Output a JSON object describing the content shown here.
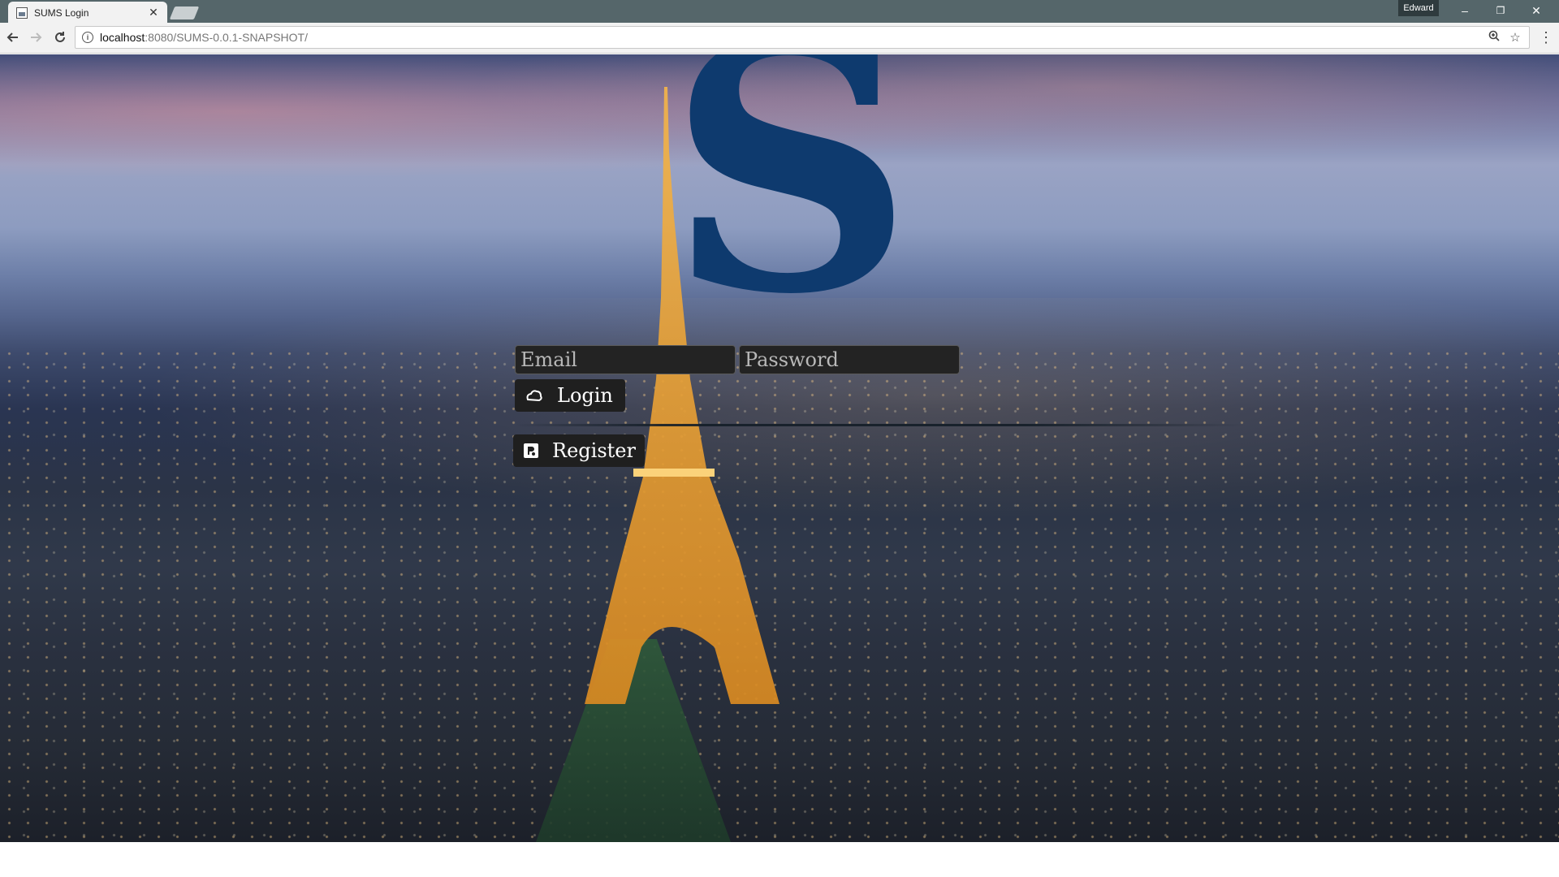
{
  "browser": {
    "tab_title": "SUMS Login",
    "tab_close": "✕",
    "profile_name": "Edward",
    "window_controls": {
      "minimize": "–",
      "restore": "❐",
      "close": "✕"
    },
    "url_host": "localhost",
    "url_rest": ":8080/SUMS-0.0.1-SNAPSHOT/",
    "icons": [
      "back-icon",
      "forward-icon",
      "reload-icon",
      "info-icon",
      "zoom-icon",
      "star-icon",
      "menu-icon"
    ]
  },
  "page": {
    "logo_letter": "S",
    "email": {
      "placeholder": "Email",
      "value": ""
    },
    "password": {
      "placeholder": "Password",
      "value": ""
    },
    "login_label": "Login",
    "register_label": "Register",
    "colors": {
      "logo": "#0e3a6e",
      "button_bg": "#1f1f1f",
      "field_bg": "#232323"
    }
  }
}
